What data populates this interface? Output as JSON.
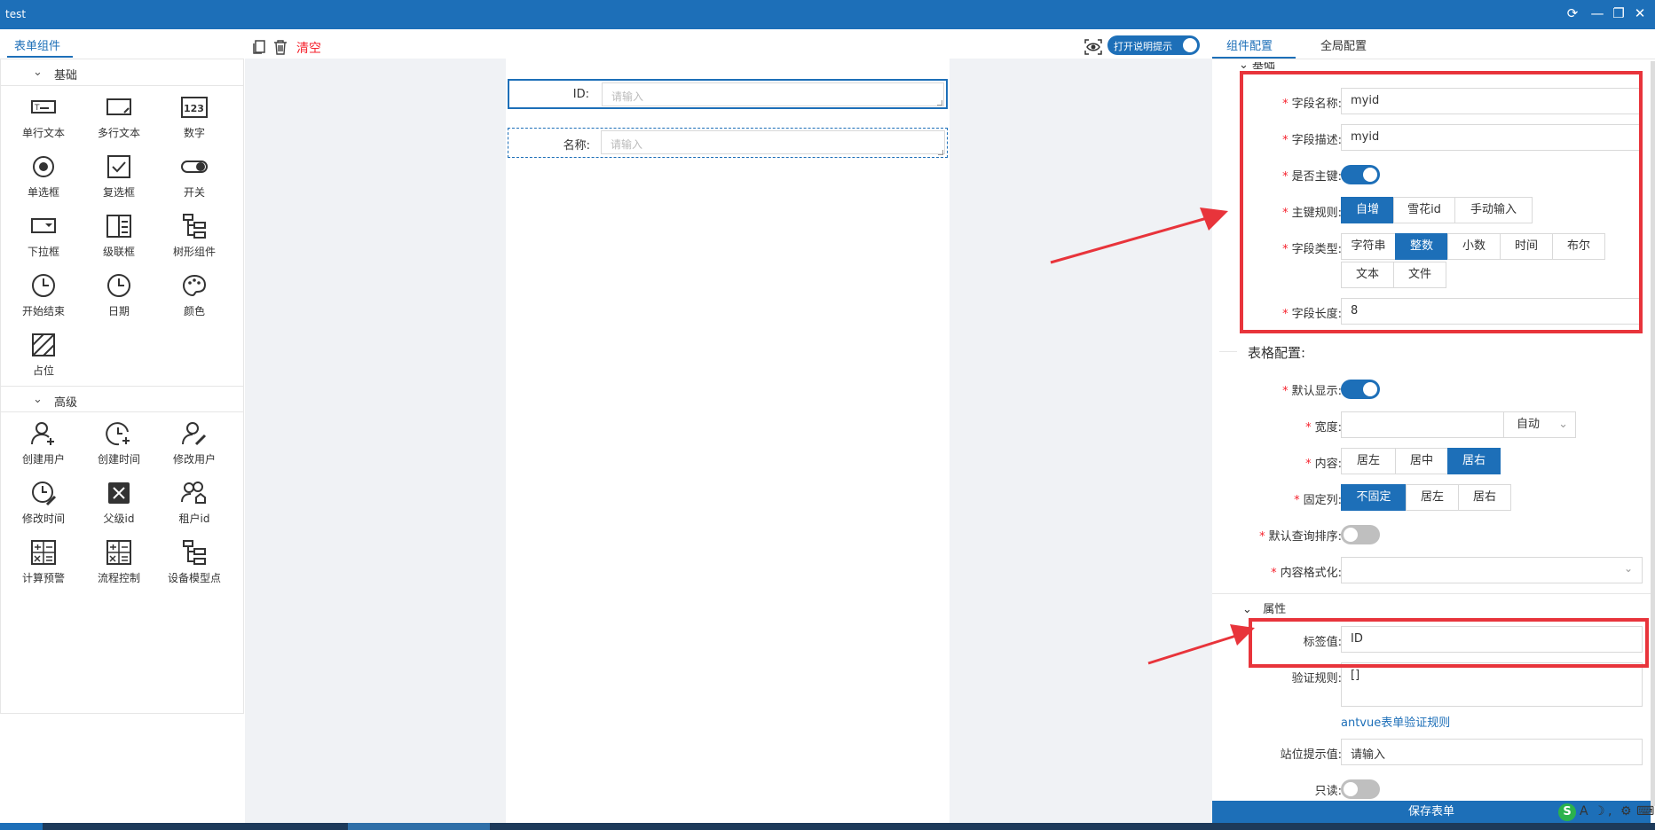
{
  "window": {
    "title": "test"
  },
  "left_panel": {
    "tab_label": "表单组件",
    "groups": [
      {
        "label": "基础",
        "items": [
          "单行文本",
          "多行文本",
          "数字",
          "单选框",
          "复选框",
          "开关",
          "下拉框",
          "级联框",
          "树形组件",
          "开始结束",
          "日期",
          "颜色",
          "占位"
        ]
      },
      {
        "label": "高级",
        "items": [
          "创建用户",
          "创建时间",
          "修改用户",
          "修改时间",
          "父级id",
          "租户id",
          "计算预警",
          "流程控制",
          "设备模型点"
        ]
      }
    ]
  },
  "toolbar": {
    "clear_label": "清空",
    "help_toggle_label": "打开说明提示"
  },
  "canvas": {
    "fields": [
      {
        "label": "ID:",
        "placeholder": "请输入"
      },
      {
        "label": "名称:",
        "placeholder": "请输入"
      }
    ]
  },
  "right_panel": {
    "tabs": [
      "组件配置",
      "全局配置"
    ],
    "basic_section_label": "基础",
    "field_name_label": "字段名称:",
    "field_name_value": "myid",
    "field_desc_label": "字段描述:",
    "field_desc_value": "myid",
    "primary_key_label": "是否主键:",
    "pk_rule_label": "主键规则:",
    "pk_rule_options": [
      "自增",
      "雪花id",
      "手动输入"
    ],
    "pk_rule_selected": "自增",
    "field_type_label": "字段类型:",
    "field_type_options": [
      "字符串",
      "整数",
      "小数",
      "时间",
      "布尔",
      "文本",
      "文件"
    ],
    "field_type_selected": "整数",
    "field_length_label": "字段长度:",
    "field_length_value": "8",
    "table_config_label": "表格配置:",
    "default_show_label": "默认显示:",
    "width_label": "宽度:",
    "width_unit": "自动",
    "content_label": "内容:",
    "content_options": [
      "居左",
      "居中",
      "居右"
    ],
    "content_selected": "居右",
    "fixed_col_label": "固定列:",
    "fixed_col_options": [
      "不固定",
      "居左",
      "居右"
    ],
    "fixed_col_selected": "不固定",
    "default_sort_label": "默认查询排序:",
    "content_format_label": "内容格式化:",
    "attr_section_label": "属性",
    "tag_value_label": "标签值:",
    "tag_value": "ID",
    "validation_label": "验证规则:",
    "validation_value": "[]",
    "validation_link": "antvue表单验证规则",
    "placeholder_label": "站位提示值:",
    "placeholder_value": "请输入",
    "readonly_label": "只读:",
    "save_label": "保存表单"
  },
  "colors": {
    "brand": "#1d6fb8",
    "danger": "#f5222d",
    "annotation": "#e8343b"
  }
}
